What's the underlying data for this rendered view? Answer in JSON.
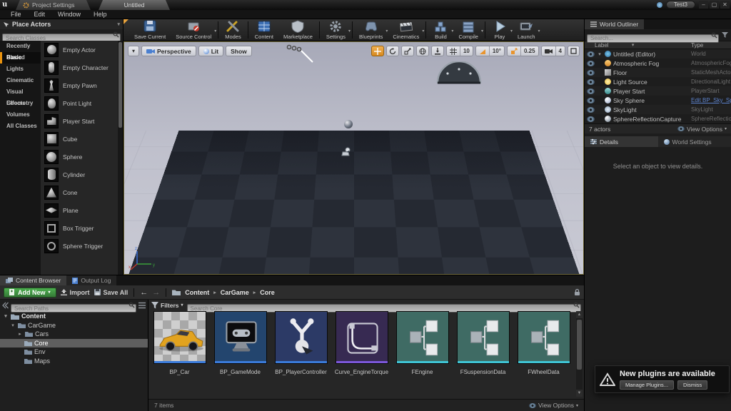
{
  "titlebar": {
    "tabs": [
      {
        "label": "Project Settings"
      },
      {
        "label": "Untitled"
      }
    ],
    "user_button": "Test3",
    "window_controls": {
      "minimize": "–",
      "maximize": "▢",
      "close": "✕"
    }
  },
  "menubar": {
    "items": [
      {
        "label": "File"
      },
      {
        "label": "Edit"
      },
      {
        "label": "Window"
      },
      {
        "label": "Help"
      }
    ]
  },
  "place_actors": {
    "title": "Place Actors",
    "search_placeholder": "Search Classes",
    "categories": [
      {
        "label": "Recently Placed"
      },
      {
        "label": "Basic"
      },
      {
        "label": "Lights"
      },
      {
        "label": "Cinematic"
      },
      {
        "label": "Visual Effects"
      },
      {
        "label": "Geometry"
      },
      {
        "label": "Volumes"
      },
      {
        "label": "All Classes"
      }
    ],
    "selected_category": "Basic",
    "items": [
      {
        "label": "Empty Actor"
      },
      {
        "label": "Empty Character"
      },
      {
        "label": "Empty Pawn"
      },
      {
        "label": "Point Light"
      },
      {
        "label": "Player Start"
      },
      {
        "label": "Cube"
      },
      {
        "label": "Sphere"
      },
      {
        "label": "Cylinder"
      },
      {
        "label": "Cone"
      },
      {
        "label": "Plane"
      },
      {
        "label": "Box Trigger"
      },
      {
        "label": "Sphere Trigger"
      }
    ]
  },
  "toolbar": {
    "buttons": [
      {
        "label": "Save Current"
      },
      {
        "label": "Source Control"
      },
      {
        "label": "Modes"
      },
      {
        "label": "Content"
      },
      {
        "label": "Marketplace"
      },
      {
        "label": "Settings"
      },
      {
        "label": "Blueprints"
      },
      {
        "label": "Cinematics"
      },
      {
        "label": "Build"
      },
      {
        "label": "Compile"
      },
      {
        "label": "Play"
      },
      {
        "label": "Launch"
      }
    ]
  },
  "viewport": {
    "perspective_label": "Perspective",
    "lit_label": "Lit",
    "show_label": "Show",
    "snapping": {
      "grid": "10",
      "rotation": "10°",
      "scale": "0.25",
      "camera_speed": "4"
    }
  },
  "world_outliner": {
    "title": "World Outliner",
    "search_placeholder": "Search...",
    "columns": {
      "label": "Label",
      "type": "Type"
    },
    "rows": [
      {
        "label": "Untitled (Editor)",
        "type": "World"
      },
      {
        "label": "Atmospheric Fog",
        "type": "AtmosphericFog"
      },
      {
        "label": "Floor",
        "type": "StaticMeshActor"
      },
      {
        "label": "Light Source",
        "type": "DirectionalLight"
      },
      {
        "label": "Player Start",
        "type": "PlayerStart"
      },
      {
        "label": "Sky Sphere",
        "type": "Edit BP_Sky_Sph"
      },
      {
        "label": "SkyLight",
        "type": "SkyLight"
      },
      {
        "label": "SphereReflectionCapture",
        "type": "SphereReflectionC"
      }
    ],
    "footer": {
      "count": "7 actors",
      "view_options": "View Options"
    }
  },
  "details_panel": {
    "tabs": [
      {
        "label": "Details"
      },
      {
        "label": "World Settings"
      }
    ],
    "empty_message": "Select an object to view details."
  },
  "content_browser": {
    "tabs": [
      {
        "label": "Content Browser"
      },
      {
        "label": "Output Log"
      }
    ],
    "toolbar": {
      "add_new": "Add New",
      "import": "Import",
      "save_all": "Save All"
    },
    "breadcrumb": [
      {
        "label": "Content"
      },
      {
        "label": "CarGame"
      },
      {
        "label": "Core"
      }
    ],
    "sources": {
      "search_placeholder": "Search Paths",
      "tree": [
        {
          "label": "Content"
        },
        {
          "label": "CarGame"
        },
        {
          "label": "Cars"
        },
        {
          "label": "Core"
        },
        {
          "label": "Env"
        },
        {
          "label": "Maps"
        }
      ],
      "selected": "Core"
    },
    "filters_label": "Filters",
    "search_placeholder": "Search Core",
    "assets": [
      {
        "name": "BP_Car"
      },
      {
        "name": "BP_GameMode"
      },
      {
        "name": "BP_PlayerController"
      },
      {
        "name": "Curve_EngineTorque"
      },
      {
        "name": "FEngine"
      },
      {
        "name": "FSuspensionData"
      },
      {
        "name": "FWheelData"
      }
    ],
    "status": {
      "count": "7 items",
      "view_options": "View Options"
    }
  },
  "notification": {
    "title": "New plugins are available",
    "buttons": [
      {
        "label": "Manage Plugins..."
      },
      {
        "label": "Dismiss"
      }
    ]
  },
  "colors": {
    "accent_orange": "#e8920e",
    "blueprint_blue": "#3a7ad8",
    "curve_purple": "#7b57d8",
    "struct_cyan": "#3fc4d4",
    "add_new_green": "#4cae4e",
    "link_blue": "#5d83cc"
  }
}
